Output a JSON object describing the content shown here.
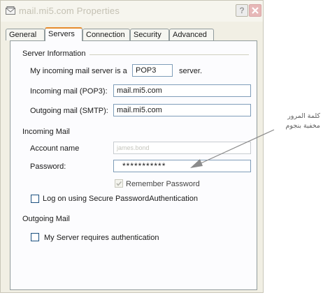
{
  "window": {
    "title": "mail.mi5.com Properties",
    "help_label": "?"
  },
  "tabs": [
    {
      "label": "General"
    },
    {
      "label": "Servers"
    },
    {
      "label": "Connection"
    },
    {
      "label": "Security"
    },
    {
      "label": "Advanced"
    }
  ],
  "server_info": {
    "group_label": "Server Information",
    "incoming_type_prefix": "My incoming mail server is a",
    "incoming_type_value": "POP3",
    "incoming_type_suffix": "server.",
    "incoming_label": "Incoming mail (POP3):",
    "incoming_value": "mail.mi5.com",
    "outgoing_label": "Outgoing mail (SMTP):",
    "outgoing_value": "mail.mi5.com"
  },
  "incoming_mail": {
    "group_label": "Incoming Mail",
    "account_label": "Account name",
    "account_value": "james.bond",
    "password_label": "Password:",
    "password_value": "***********",
    "remember_label": "Remember Password",
    "remember_checked": true,
    "spa_label": "Log on using Secure PasswordAuthentication",
    "spa_checked": false
  },
  "outgoing_mail": {
    "group_label": "Outgoing Mail",
    "requires_auth_label": "My Server requires authentication",
    "requires_auth_checked": false
  },
  "annotation": {
    "line1": "كلمة المرور",
    "line2": "مخفية بنجوم"
  },
  "colors": {
    "tab_highlight": "#e68b2c",
    "close_button": "#e7b8b8",
    "field_border": "#7f9db9"
  }
}
